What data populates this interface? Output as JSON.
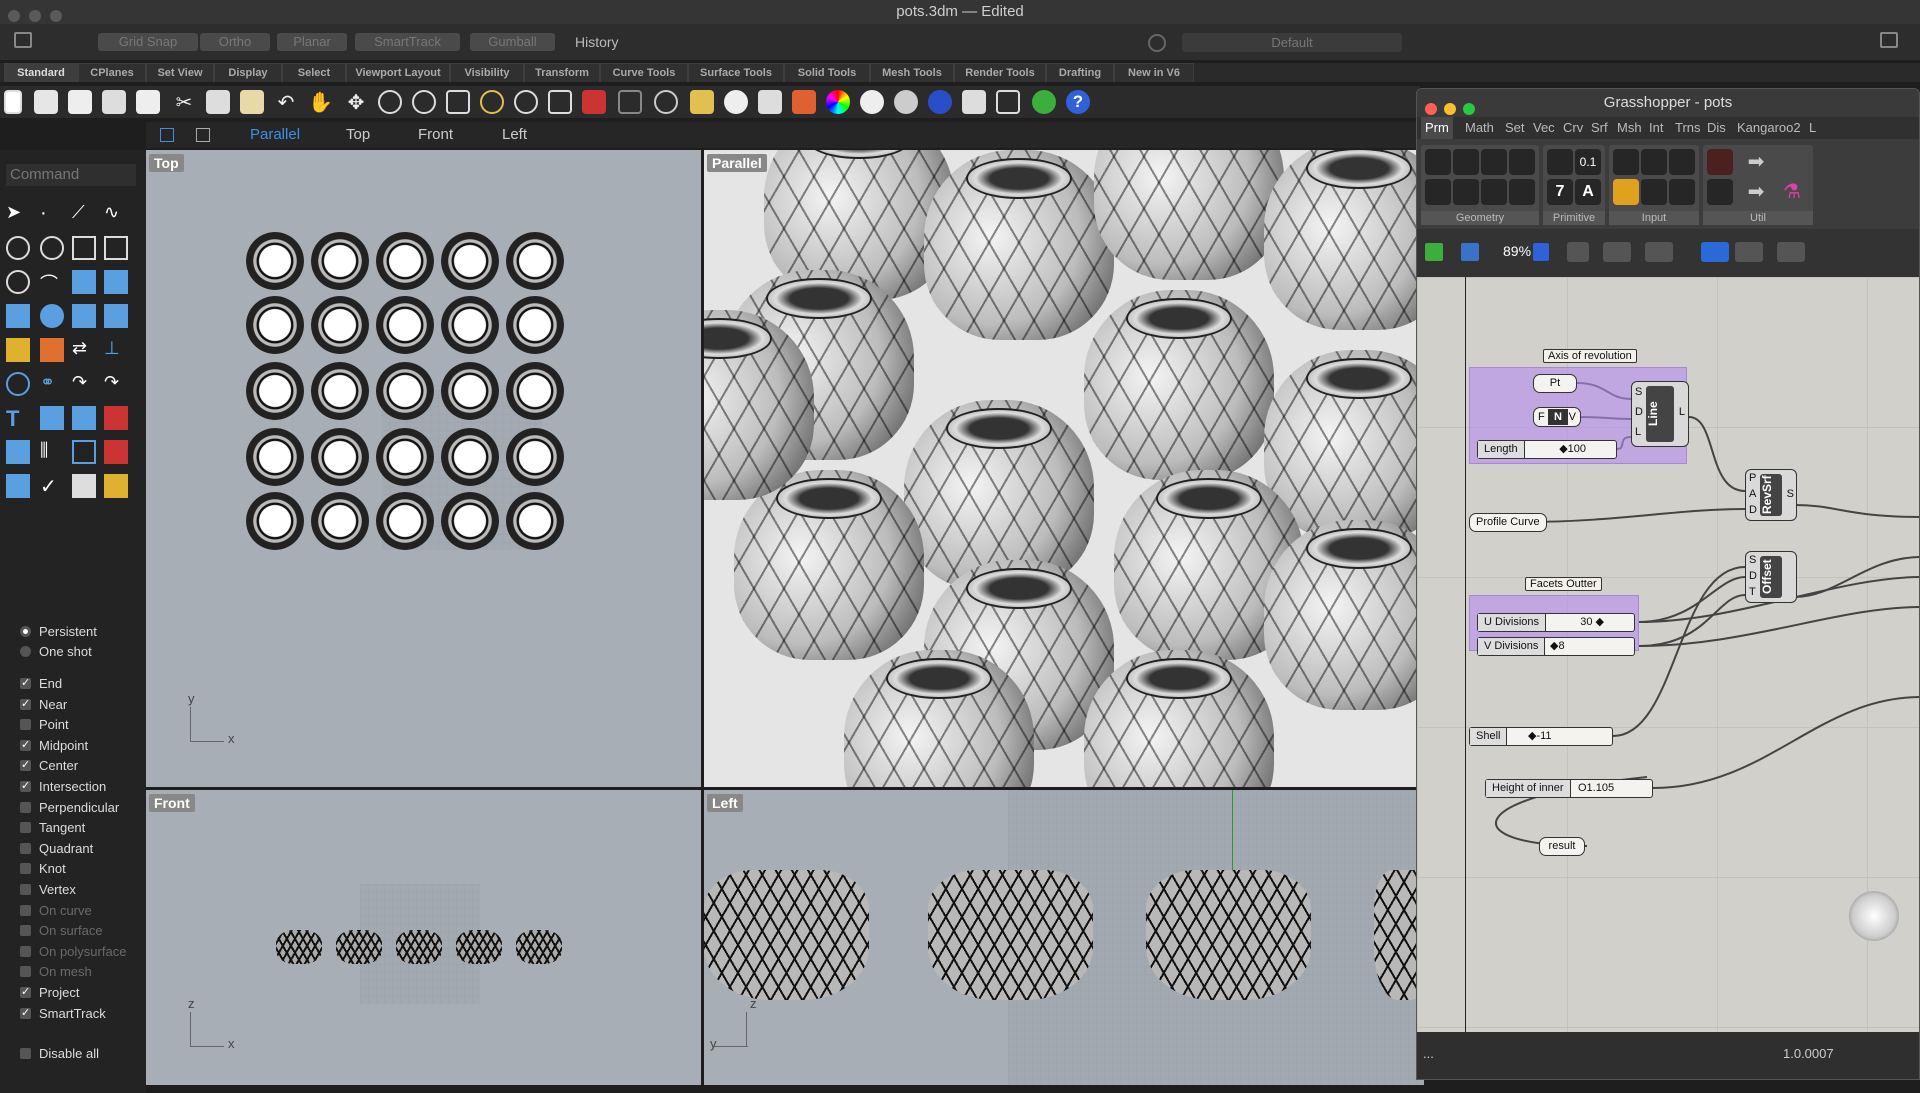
{
  "app": {
    "window_title": "pots.3dm — Edited"
  },
  "modebar": {
    "grid_snap": "Grid Snap",
    "ortho": "Ortho",
    "planar": "Planar",
    "smarttrack": "SmartTrack",
    "gumball": "Gumball",
    "history": "History",
    "named_position": "Default"
  },
  "tabs": [
    "Standard",
    "CPlanes",
    "Set View",
    "Display",
    "Select",
    "Viewport Layout",
    "Visibility",
    "Transform",
    "Curve Tools",
    "Surface Tools",
    "Solid Tools",
    "Mesh Tools",
    "Render Tools",
    "Drafting",
    "New in V6"
  ],
  "viewport_tabs": {
    "parallel": "Parallel",
    "top": "Top",
    "front": "Front",
    "left": "Left"
  },
  "command_placeholder": "Command",
  "osnaps": {
    "persistent": "Persistent",
    "one_shot": "One shot",
    "items": [
      {
        "label": "End",
        "checked": true,
        "enabled": true
      },
      {
        "label": "Near",
        "checked": true,
        "enabled": true
      },
      {
        "label": "Point",
        "checked": false,
        "enabled": true
      },
      {
        "label": "Midpoint",
        "checked": true,
        "enabled": true
      },
      {
        "label": "Center",
        "checked": true,
        "enabled": true
      },
      {
        "label": "Intersection",
        "checked": true,
        "enabled": true
      },
      {
        "label": "Perpendicular",
        "checked": false,
        "enabled": true
      },
      {
        "label": "Tangent",
        "checked": false,
        "enabled": true
      },
      {
        "label": "Quadrant",
        "checked": false,
        "enabled": true
      },
      {
        "label": "Knot",
        "checked": false,
        "enabled": true
      },
      {
        "label": "Vertex",
        "checked": false,
        "enabled": true
      },
      {
        "label": "On curve",
        "checked": false,
        "enabled": false
      },
      {
        "label": "On surface",
        "checked": false,
        "enabled": false
      },
      {
        "label": "On polysurface",
        "checked": false,
        "enabled": false
      },
      {
        "label": "On mesh",
        "checked": false,
        "enabled": false
      },
      {
        "label": "Project",
        "checked": true,
        "enabled": true
      },
      {
        "label": "SmartTrack",
        "checked": true,
        "enabled": true
      }
    ],
    "disable_all": "Disable all"
  },
  "viewports": {
    "top": "Top",
    "parallel": "Parallel",
    "front": "Front",
    "left": "Left"
  },
  "axes": {
    "x": "x",
    "y": "y",
    "z": "z"
  },
  "grasshopper": {
    "title": "Grasshopper - pots",
    "tabs": [
      "Prm",
      "Math",
      "Set",
      "Vec",
      "Crv",
      "Srf",
      "Msh",
      "Int",
      "Trns",
      "Dis",
      "Kangaroo2",
      "L"
    ],
    "groups": [
      "Geometry",
      "Primitive",
      "Input",
      "Util"
    ],
    "primitive_labels": {
      "num": "0.1",
      "seven": "7",
      "letter": "A"
    },
    "zoom": "89%",
    "canvas": {
      "axis_group_title": "Axis of revolution",
      "pt_node": "Pt",
      "vector_node": {
        "f": "F",
        "n": "N",
        "v": "V"
      },
      "length_slider": {
        "label": "Length",
        "value": "◆100"
      },
      "line_comp": {
        "name": "Line",
        "inputs": [
          "S",
          "D",
          "L"
        ],
        "output": "L"
      },
      "revsrf_comp": {
        "name": "RevSrf",
        "inputs": [
          "P",
          "A",
          "D"
        ],
        "output": "S"
      },
      "offset_comp": {
        "name": "Offset",
        "inputs": [
          "S",
          "D",
          "T"
        ]
      },
      "profile_curve": "Profile Curve",
      "facets_group_title": "Facets Outter",
      "u_div": {
        "label": "U Divisions",
        "value": "30 ◆"
      },
      "v_div": {
        "label": "V Divisions",
        "value": "◆8"
      },
      "shell": {
        "label": "Shell",
        "value": "◆-11"
      },
      "height_inner": {
        "label": "Height of inner",
        "value": "O1.105"
      },
      "result": "result"
    },
    "status": {
      "left": "...",
      "version": "1.0.0007"
    }
  }
}
